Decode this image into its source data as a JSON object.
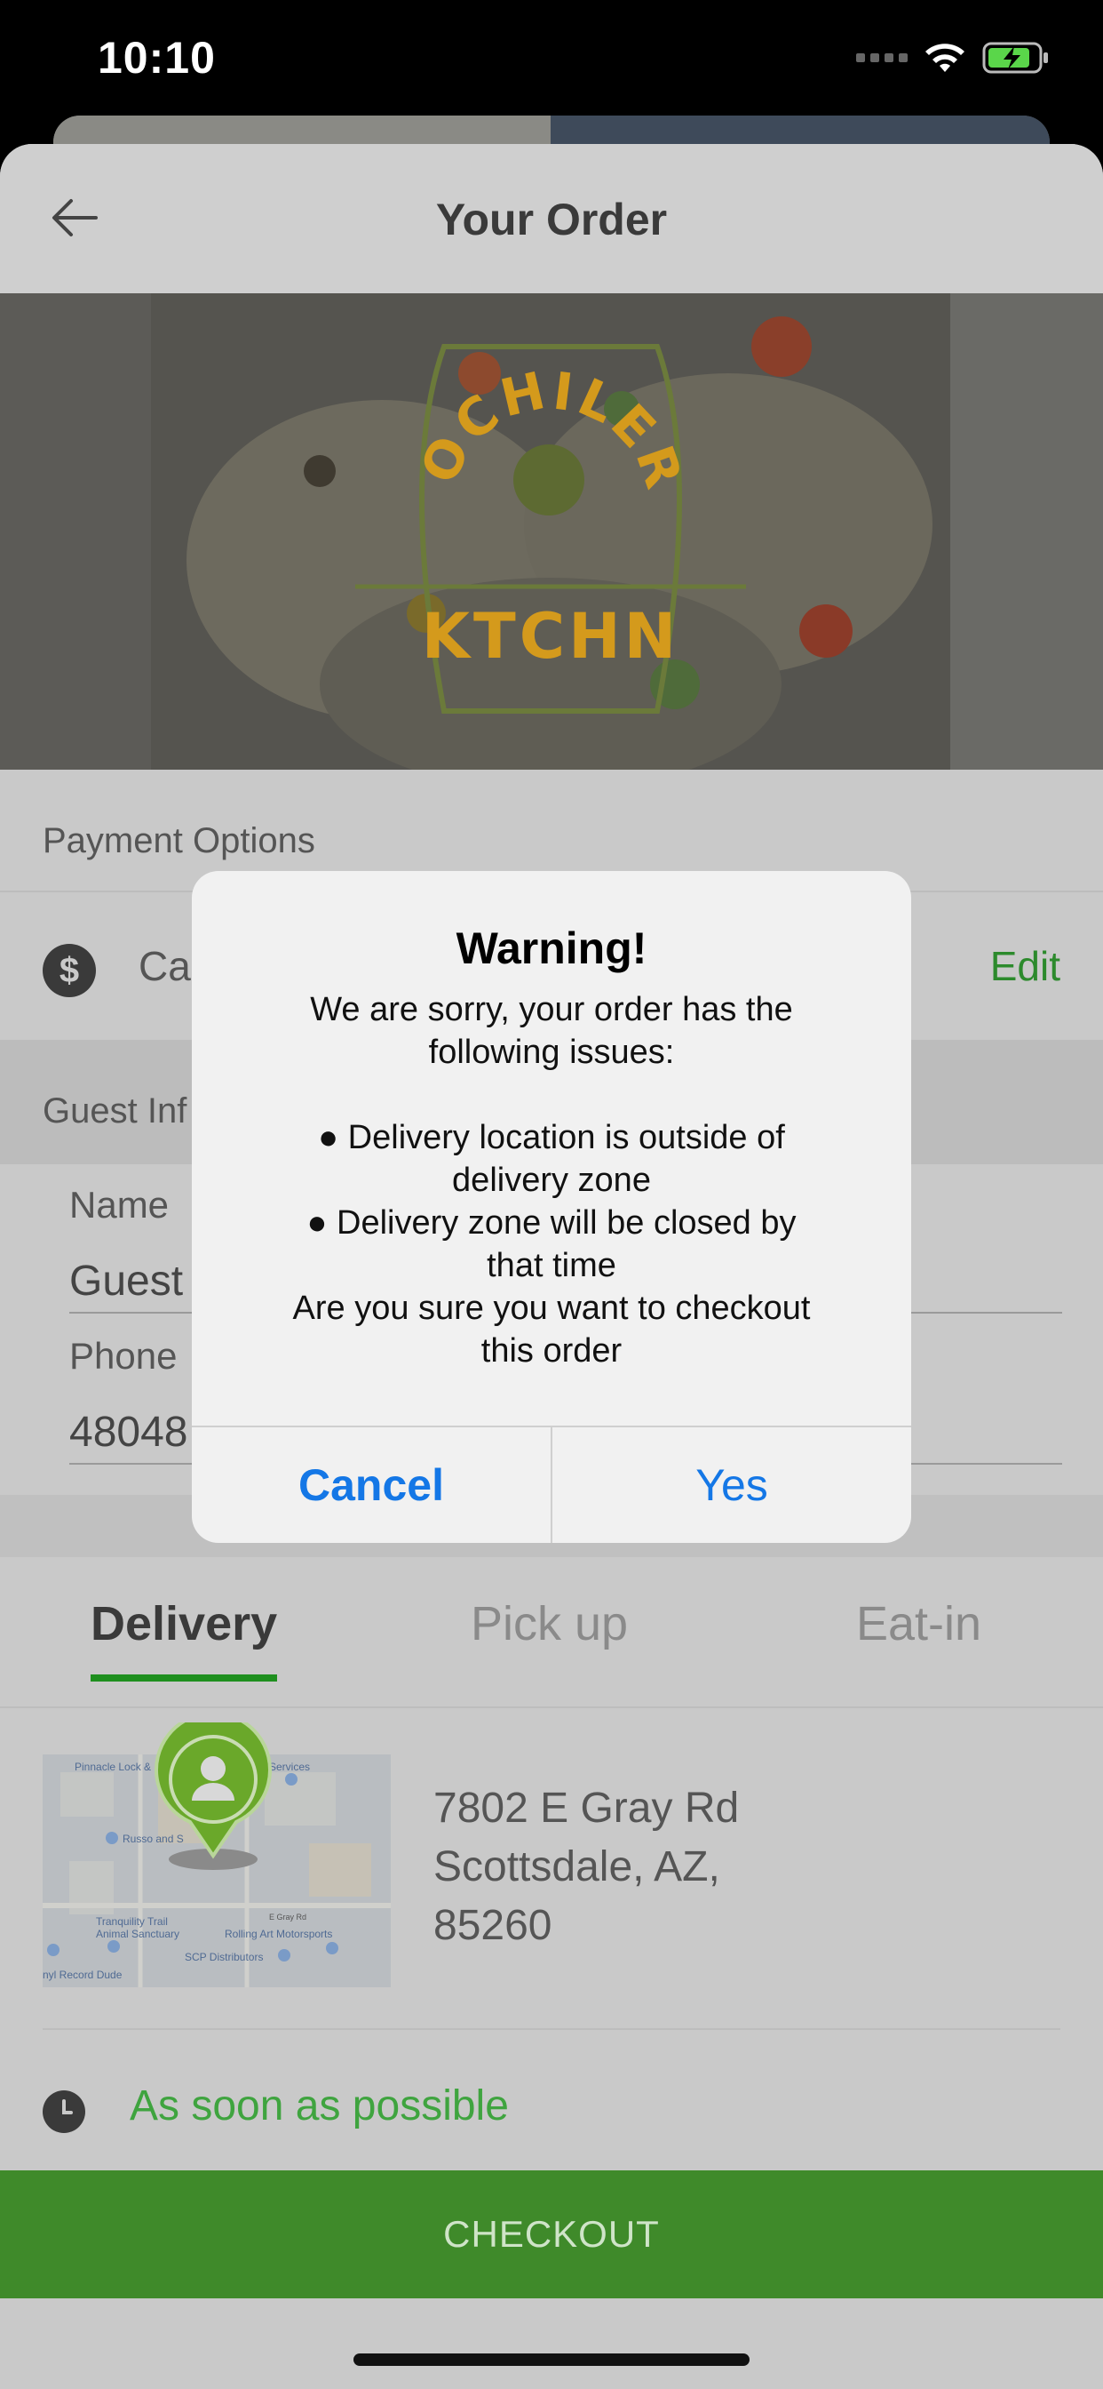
{
  "status_bar": {
    "time": "10:10",
    "icons": [
      "signal-dots-icon",
      "wifi-icon",
      "battery-charging-icon"
    ]
  },
  "navbar": {
    "title": "Your Order",
    "back_icon": "arrow-left-icon"
  },
  "hero": {
    "logo_text_top": "MOCHILERO",
    "logo_text_bottom": "KTCHN",
    "logo_color": "#d49a1c"
  },
  "payment": {
    "section_label": "Payment Options",
    "method_partial": "Ca",
    "edit_label": "Edit",
    "icon": "dollar-icon"
  },
  "guest": {
    "section_label_partial": "Guest Inf",
    "name_label": "Name",
    "name_value_partial": "Guest",
    "phone_label": "Phone",
    "phone_value_partial": "48048"
  },
  "order_type_tabs": [
    {
      "label": "Delivery",
      "active": true
    },
    {
      "label": "Pick up",
      "active": false
    },
    {
      "label": "Eat-in",
      "active": false
    }
  ],
  "delivery": {
    "address_line1": "7802 E Gray Rd",
    "address_line2": "Scottsdale, AZ,",
    "address_line3": "85260",
    "map_labels": [
      "Pinnacle Lock &",
      "Services",
      "Russo and S",
      "Tranquility Trail",
      "Animal Sanctuary",
      "Rolling Art Motorsports",
      "E Gray Rd",
      "SCP Distributors",
      "nyl Record Dude"
    ]
  },
  "time": {
    "label": "As soon as possible",
    "icon": "clock-icon"
  },
  "checkout": {
    "label": "CHECKOUT"
  },
  "alert": {
    "title": "Warning!",
    "intro_line1": "We are sorry, your order has the",
    "intro_line2": "following issues:",
    "issue1_line1": "● Delivery location is outside of",
    "issue1_line2": "delivery zone",
    "issue2_line1": "● Delivery zone will be closed by",
    "issue2_line2": "that time",
    "question_line1": "Are you sure you want to checkout",
    "question_line2": "this order",
    "cancel_label": "Cancel",
    "yes_label": "Yes"
  },
  "colors": {
    "accent_green": "#1e8f1e",
    "checkout_green": "#3f8a2a",
    "link_blue": "#1477e6",
    "asap_green": "#3fa43f"
  }
}
